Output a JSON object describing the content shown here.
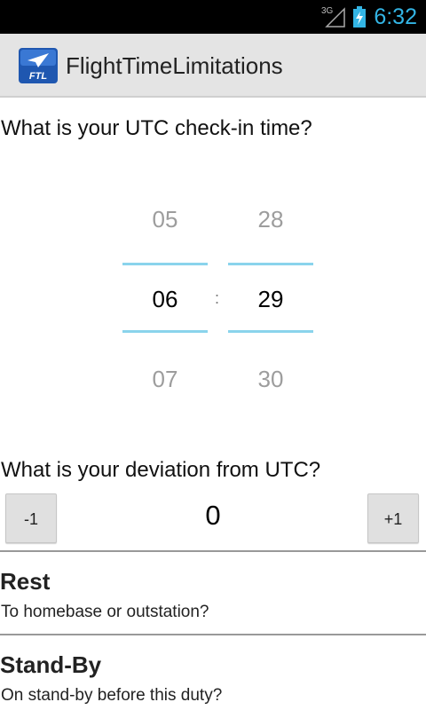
{
  "status_bar": {
    "network": "3G",
    "time": "6:32"
  },
  "app": {
    "icon_text": "FTL",
    "title": "FlightTimeLimitations"
  },
  "checkin": {
    "question": "What is your UTC check-in time?",
    "hours": {
      "above": "05",
      "selected": "06",
      "below": "07"
    },
    "minutes": {
      "above": "28",
      "selected": "29",
      "below": "30"
    },
    "separator": ":"
  },
  "deviation": {
    "question": "What is your deviation from UTC?",
    "minus_label": "-1",
    "value": "0",
    "plus_label": "+1"
  },
  "rest": {
    "title": "Rest",
    "subtitle": "To homebase or outstation?"
  },
  "standby": {
    "title": "Stand-By",
    "subtitle": "On stand-by before this duty?"
  },
  "colors": {
    "accent": "#33b5e5",
    "picker_line": "#8ad4ec",
    "icon_blue": "#1f57b0"
  }
}
